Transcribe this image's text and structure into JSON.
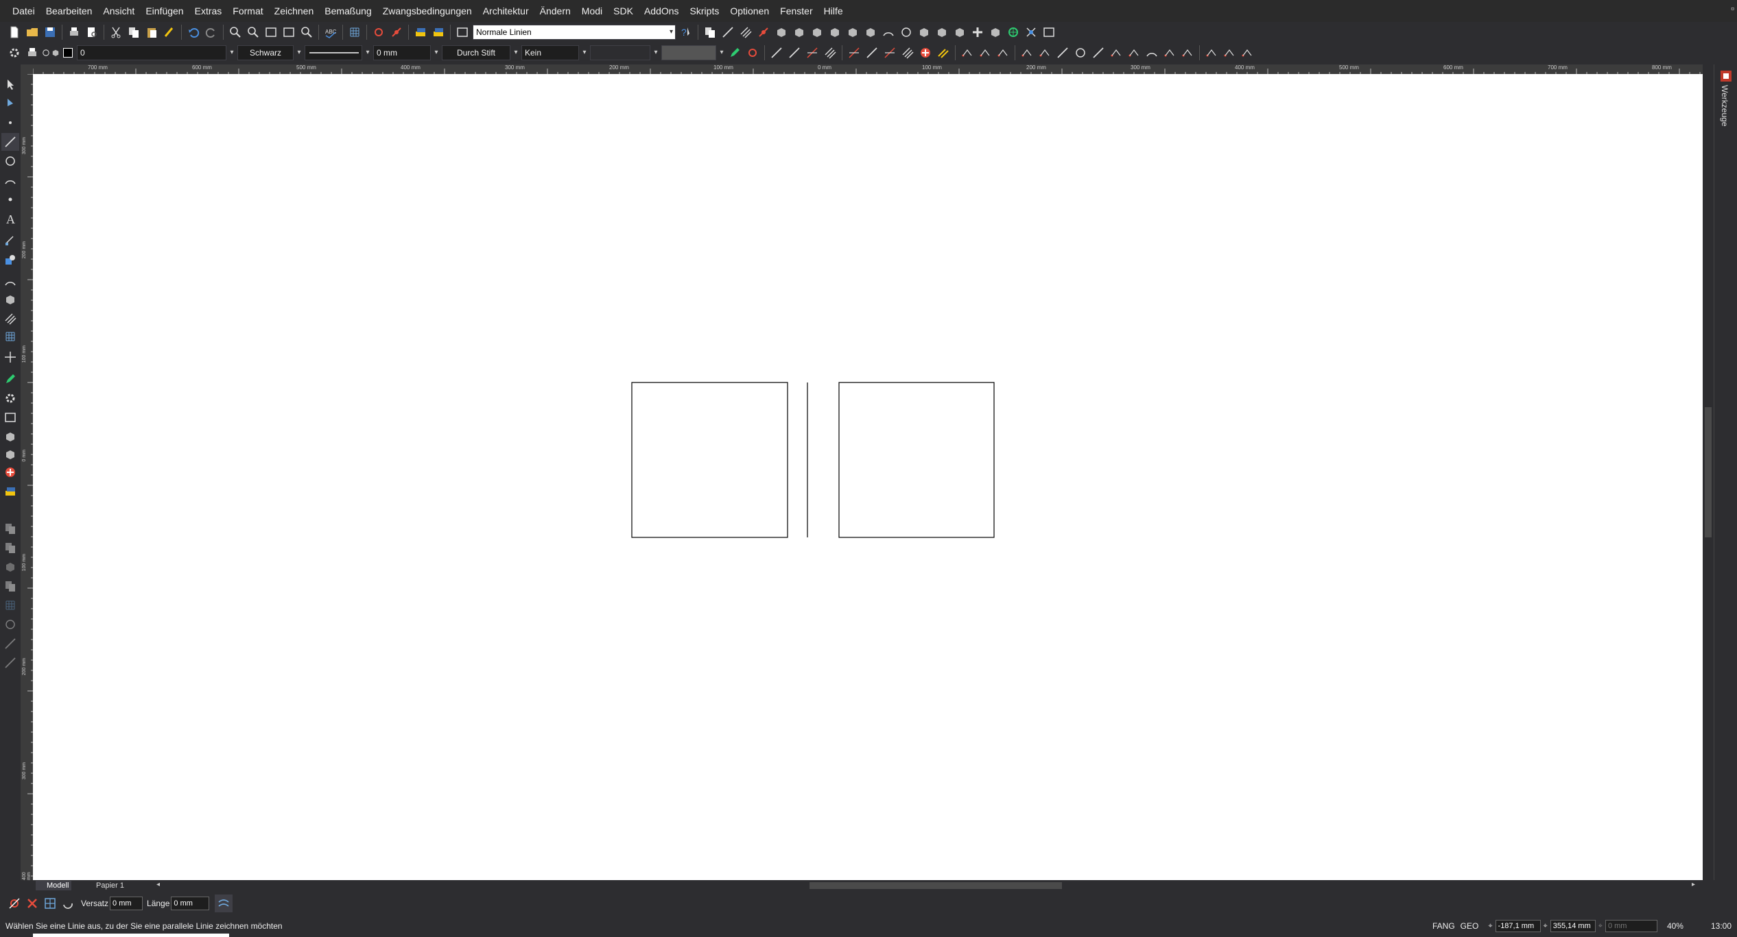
{
  "menu": [
    "Datei",
    "Bearbeiten",
    "Ansicht",
    "Einfügen",
    "Extras",
    "Format",
    "Zeichnen",
    "Bemaßung",
    "Zwangsbedingungen",
    "Architektur",
    "Ändern",
    "Modi",
    "SDK",
    "AddOns",
    "Skripts",
    "Optionen",
    "Fenster",
    "Hilfe"
  ],
  "toolbar": {
    "linestyle_combo": "Normale Linien",
    "layer_value": "0",
    "color_value": "Schwarz",
    "width_value": "0 mm",
    "pen_value": "Durch Stift",
    "fill_value": "Kein"
  },
  "ruler": {
    "labels": [
      "700 mm",
      "600 mm",
      "500 mm",
      "400 mm",
      "300 mm",
      "200 mm",
      "100 mm",
      "0 mm",
      "100 mm",
      "200 mm",
      "300 mm",
      "400 mm",
      "500 mm",
      "600 mm",
      "700 mm",
      "800 mm"
    ],
    "vertical_labels": [
      "300 mm",
      "200 mm",
      "100 mm",
      "0 mm",
      "100 mm",
      "200 mm",
      "300 mm",
      "400 mm"
    ]
  },
  "side_panel": {
    "label": "Werkzeuge"
  },
  "tabs": [
    {
      "label": "Modell",
      "active": true
    },
    {
      "label": "Papier 1",
      "active": false
    }
  ],
  "input": {
    "versatz_label": "Versatz",
    "versatz_value": "0 mm",
    "laenge_label": "Länge",
    "laenge_value": "0 mm"
  },
  "status": {
    "message": "Wählen Sie eine Linie aus, zu der Sie eine parallele Linie zeichnen möchten",
    "snap1": "FANG",
    "snap2": "GEO",
    "coord_x": "-187,1 mm",
    "coord_y": "355,14 mm",
    "coord_z": "0 mm",
    "zoom": "40%",
    "time": "13:00"
  },
  "colors": {
    "accent": "#3399ff",
    "background": "#2d2d30",
    "canvas": "#ffffff"
  }
}
